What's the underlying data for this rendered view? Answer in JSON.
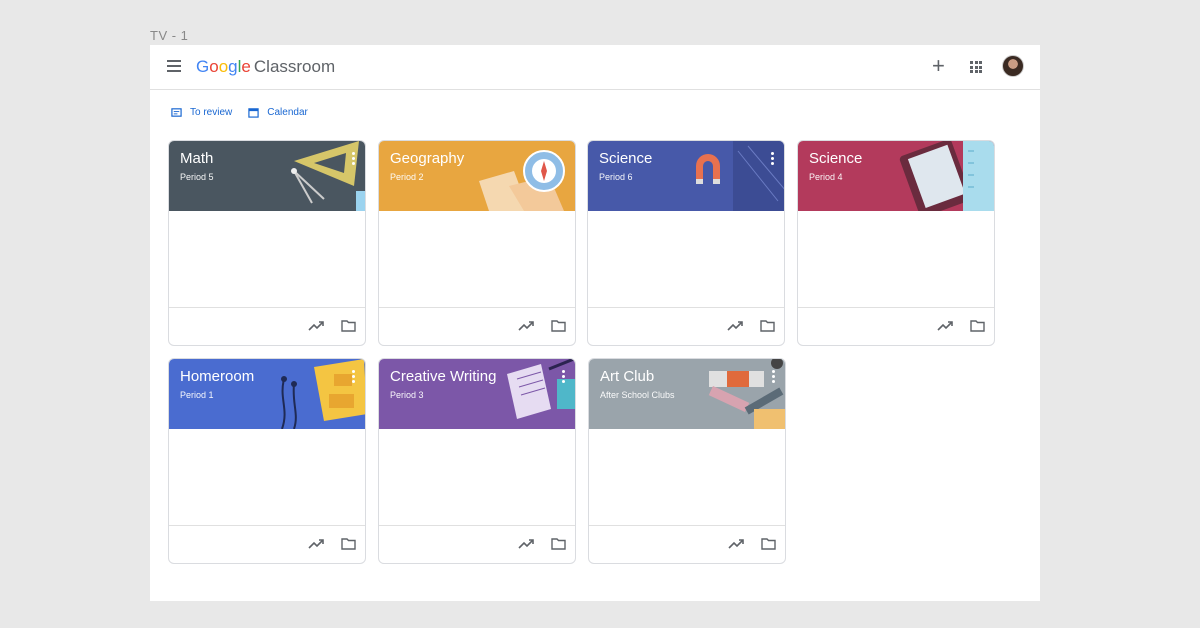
{
  "frame_label": "TV - 1",
  "header": {
    "logo": {
      "g1": "G",
      "g2": "o",
      "g3": "o",
      "g4": "g",
      "g5": "l",
      "g6": "e",
      "product": "Classroom"
    }
  },
  "subnav": {
    "to_review": "To review",
    "calendar": "Calendar"
  },
  "colors": {
    "math": "#4a5660",
    "geography": "#e8a640",
    "science6": "#4759a9",
    "science4": "#b33a5c",
    "homeroom": "#4a6cd0",
    "creative": "#7c57a8",
    "artclub": "#9aa4ab"
  },
  "classes": [
    {
      "title": "Math",
      "subtitle": "Period 5"
    },
    {
      "title": "Geography",
      "subtitle": "Period 2"
    },
    {
      "title": "Science",
      "subtitle": "Period 6"
    },
    {
      "title": "Science",
      "subtitle": "Period 4"
    },
    {
      "title": "Homeroom",
      "subtitle": "Period 1"
    },
    {
      "title": "Creative Writing",
      "subtitle": "Period 3"
    },
    {
      "title": "Art Club",
      "subtitle": "After School Clubs"
    }
  ]
}
